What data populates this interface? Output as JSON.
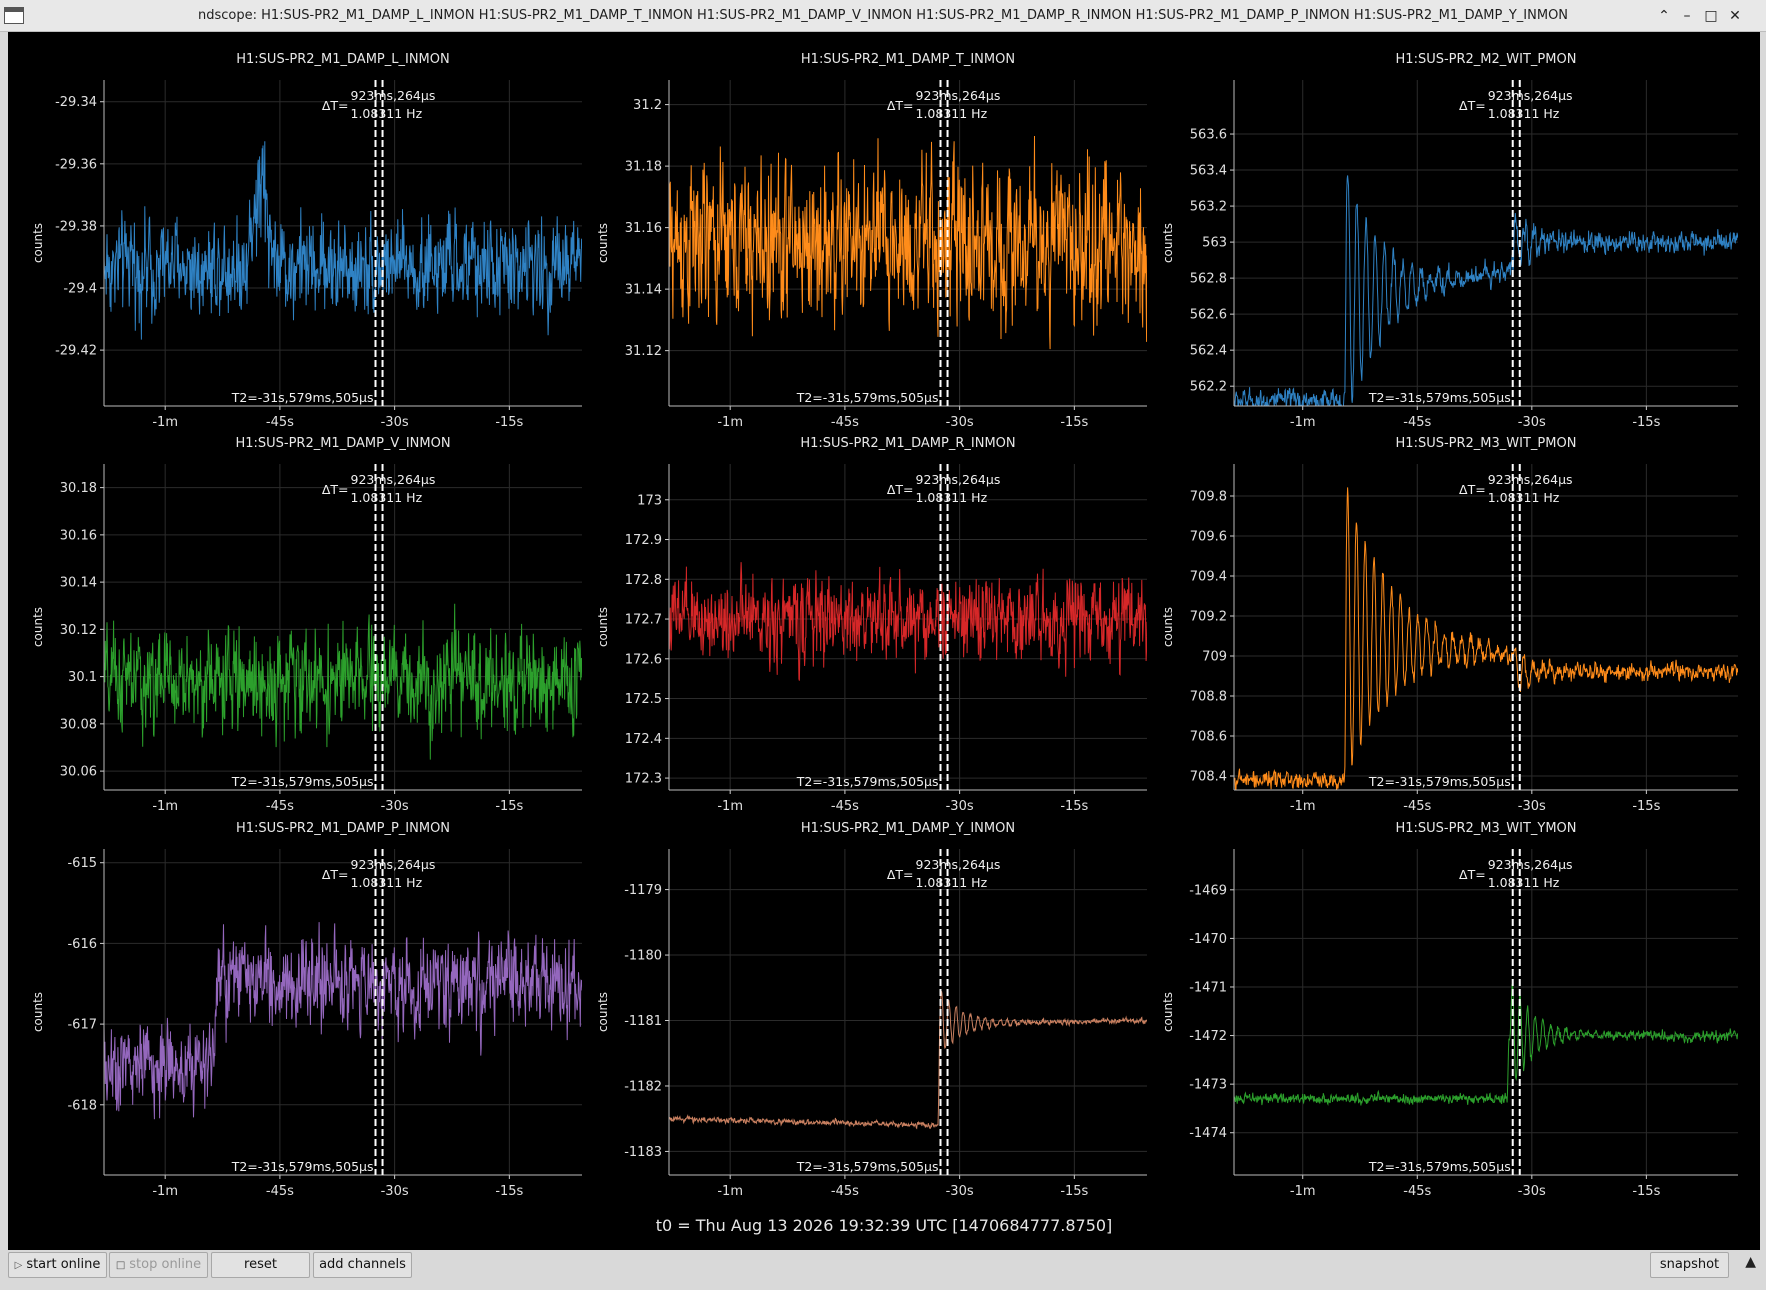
{
  "window": {
    "title": "ndscope: H1:SUS-PR2_M1_DAMP_L_INMON H1:SUS-PR2_M1_DAMP_T_INMON H1:SUS-PR2_M1_DAMP_V_INMON H1:SUS-PR2_M1_DAMP_R_INMON H1:SUS-PR2_M1_DAMP_P_INMON H1:SUS-PR2_M1_DAMP_Y_INMON",
    "controls": {
      "minimize": "⌃",
      "shade": "–",
      "maximize": "□",
      "close": "✕"
    }
  },
  "cursor": {
    "delta_label": "ΔT=",
    "delta_time": "923ms,264μs",
    "delta_freq": "1.08311 Hz",
    "t2_label": "T2=-31s,579ms,505μs",
    "t1_seconds": -32.5,
    "t2_seconds": -31.58
  },
  "t0_label": "t0 = Thu Aug 13 2026 19:32:39 UTC [1470684777.8750]",
  "buttons": {
    "start_online": "start online",
    "stop_online": "stop online",
    "reset": "reset",
    "add_channels": "add channels",
    "snapshot": "snapshot"
  },
  "chart_data": [
    {
      "type": "line",
      "title": "H1:SUS-PR2_M1_DAMP_L_INMON",
      "ylabel": "counts",
      "color": "#2f82c4",
      "xlim": [
        -68,
        -5.5
      ],
      "ylim": [
        -29.438,
        -29.333
      ],
      "xticks": [
        -60,
        -45,
        -30,
        -15
      ],
      "xtick_labels": [
        "-1m",
        "-45s",
        "-30s",
        "-15s"
      ],
      "yticks": [
        -29.34,
        -29.36,
        -29.38,
        -29.4,
        -29.42
      ],
      "yticks_labels": [
        "-29.34",
        "-29.36",
        "-29.38",
        "-29.4",
        "-29.42"
      ],
      "grid": true,
      "series": [
        {
          "shape": [
            [
              -68,
              -29.393
            ],
            [
              -5.5,
              -29.393
            ]
          ],
          "noise": 0.009,
          "spikes": [
            [
              -47.5,
              0.035
            ]
          ]
        }
      ]
    },
    {
      "type": "line",
      "title": "H1:SUS-PR2_M1_DAMP_T_INMON",
      "ylabel": "counts",
      "color": "#ff8c1a",
      "xlim": [
        -68,
        -5.5
      ],
      "ylim": [
        31.102,
        31.208
      ],
      "xticks": [
        -60,
        -45,
        -30,
        -15
      ],
      "xtick_labels": [
        "-1m",
        "-45s",
        "-30s",
        "-15s"
      ],
      "yticks": [
        31.2,
        31.18,
        31.16,
        31.14,
        31.12
      ],
      "yticks_labels": [
        "31.2",
        "31.18",
        "31.16",
        "31.14",
        "31.12"
      ],
      "grid": true,
      "series": [
        {
          "shape": [
            [
              -68,
              31.155
            ],
            [
              -5.5,
              31.155
            ]
          ],
          "noise": 0.015
        }
      ]
    },
    {
      "type": "line",
      "title": "H1:SUS-PR2_M2_WIT_PMON",
      "ylabel": "counts",
      "color": "#2f82c4",
      "xlim": [
        -69,
        -3
      ],
      "ylim": [
        562.09,
        563.9
      ],
      "xticks": [
        -60,
        -45,
        -30,
        -15
      ],
      "xtick_labels": [
        "-1m",
        "-45s",
        "-30s",
        "-15s"
      ],
      "yticks": [
        563.6,
        563.4,
        563.2,
        563,
        562.8,
        562.6,
        562.4,
        562.2
      ],
      "yticks_labels": [
        "563.6",
        "563.4",
        "563.2",
        "563",
        "562.8",
        "562.6",
        "562.4",
        "562.2"
      ],
      "grid": true,
      "series": [
        {
          "shape": [
            [
              -69,
              562.12
            ],
            [
              -54.5,
              562.12
            ],
            [
              -54.3,
              562.7
            ],
            [
              -32.5,
              562.85
            ],
            [
              -32.3,
              563
            ],
            [
              -3,
              563
            ]
          ],
          "noise": 0.035,
          "ringing": [
            [
              -54.4,
              0.75,
              4.5,
              1.2
            ],
            [
              -32.4,
              0.15,
              3,
              1.2
            ]
          ]
        }
      ]
    },
    {
      "type": "line",
      "title": "H1:SUS-PR2_M1_DAMP_V_INMON",
      "ylabel": "counts",
      "color": "#2ca02c",
      "xlim": [
        -68,
        -5.5
      ],
      "ylim": [
        30.052,
        30.19
      ],
      "xticks": [
        -60,
        -45,
        -30,
        -15
      ],
      "xtick_labels": [
        "-1m",
        "-45s",
        "-30s",
        "-15s"
      ],
      "yticks": [
        30.18,
        30.16,
        30.14,
        30.12,
        30.1,
        30.08,
        30.06
      ],
      "yticks_labels": [
        "30.18",
        "30.16",
        "30.14",
        "30.12",
        "30.1",
        "30.08",
        "30.06"
      ],
      "grid": true,
      "series": [
        {
          "shape": [
            [
              -68,
              30.098
            ],
            [
              -5.5,
              30.098
            ]
          ],
          "noise": 0.012
        }
      ]
    },
    {
      "type": "line",
      "title": "H1:SUS-PR2_M1_DAMP_R_INMON",
      "ylabel": "counts",
      "color": "#d62728",
      "xlim": [
        -68,
        -5.5
      ],
      "ylim": [
        172.27,
        173.09
      ],
      "xticks": [
        -60,
        -45,
        -30,
        -15
      ],
      "xtick_labels": [
        "-1m",
        "-45s",
        "-30s",
        "-15s"
      ],
      "yticks": [
        173,
        172.9,
        172.8,
        172.7,
        172.6,
        172.5,
        172.4,
        172.3
      ],
      "yticks_labels": [
        "173",
        "172.9",
        "172.8",
        "172.7",
        "172.6",
        "172.5",
        "172.4",
        "172.3"
      ],
      "grid": true,
      "series": [
        {
          "shape": [
            [
              -68,
              172.7
            ],
            [
              -5.5,
              172.7
            ]
          ],
          "noise": 0.06
        }
      ]
    },
    {
      "type": "line",
      "title": "H1:SUS-PR2_M3_WIT_PMON",
      "ylabel": "counts",
      "color": "#ff8c1a",
      "xlim": [
        -69,
        -3
      ],
      "ylim": [
        708.33,
        709.96
      ],
      "xticks": [
        -60,
        -45,
        -30,
        -15
      ],
      "xtick_labels": [
        "-1m",
        "-45s",
        "-30s",
        "-15s"
      ],
      "yticks": [
        709.8,
        709.6,
        709.4,
        709.2,
        709,
        708.8,
        708.6,
        708.4
      ],
      "yticks_labels": [
        "709.8",
        "709.6",
        "709.4",
        "709.2",
        "709",
        "708.8",
        "708.6",
        "708.4"
      ],
      "grid": true,
      "series": [
        {
          "shape": [
            [
              -69,
              708.38
            ],
            [
              -54.5,
              708.38
            ],
            [
              -54.3,
              709.1
            ],
            [
              -32.5,
              709.0
            ],
            [
              -32.3,
              708.92
            ],
            [
              -3,
              708.92
            ]
          ],
          "noise": 0.025,
          "ringing": [
            [
              -54.4,
              0.75,
              6,
              1.15
            ],
            [
              -32.4,
              0.12,
              2.5,
              1.15
            ]
          ]
        }
      ]
    },
    {
      "type": "line",
      "title": "H1:SUS-PR2_M1_DAMP_P_INMON",
      "ylabel": "counts",
      "color": "#9467bd",
      "xlim": [
        -68,
        -5.5
      ],
      "ylim": [
        -618.87,
        -614.83
      ],
      "xticks": [
        -60,
        -45,
        -30,
        -15
      ],
      "xtick_labels": [
        "-1m",
        "-45s",
        "-30s",
        "-15s"
      ],
      "yticks": [
        -615,
        -616,
        -617,
        -618
      ],
      "yticks_labels": [
        "-615",
        "-616",
        "-617",
        "-618"
      ],
      "grid": true,
      "series": [
        {
          "shape": [
            [
              -68,
              -617.5
            ],
            [
              -53.5,
              -617.5
            ],
            [
              -53.3,
              -616.5
            ],
            [
              -5.5,
              -616.5
            ]
          ],
          "noise": 0.32
        }
      ]
    },
    {
      "type": "line",
      "title": "H1:SUS-PR2_M1_DAMP_Y_INMON",
      "ylabel": "counts",
      "color": "#c98060",
      "xlim": [
        -68,
        -5.5
      ],
      "ylim": [
        -1183.36,
        -1178.38
      ],
      "xticks": [
        -60,
        -45,
        -30,
        -15
      ],
      "xtick_labels": [
        "-1m",
        "-45s",
        "-30s",
        "-15s"
      ],
      "yticks": [
        -1179,
        -1180,
        -1181,
        -1182,
        -1183
      ],
      "yticks_labels": [
        "-1179",
        "-1180",
        "-1181",
        "-1182",
        "-1183"
      ],
      "grid": true,
      "series": [
        {
          "shape": [
            [
              -68,
              -1182.5
            ],
            [
              -32.8,
              -1182.6
            ],
            [
              -32.6,
              -1181.05
            ],
            [
              -5.5,
              -1181.0
            ]
          ],
          "noise": 0.025,
          "ringing": [
            [
              -32.6,
              0.5,
              3,
              0.95
            ]
          ]
        }
      ]
    },
    {
      "type": "line",
      "title": "H1:SUS-PR2_M3_WIT_YMON",
      "ylabel": "counts",
      "color": "#2ca02c",
      "xlim": [
        -69,
        -3
      ],
      "ylim": [
        -1474.87,
        -1468.16
      ],
      "xticks": [
        -60,
        -45,
        -30,
        -15
      ],
      "xtick_labels": [
        "-1m",
        "-45s",
        "-30s",
        "-15s"
      ],
      "yticks": [
        -1469,
        -1470,
        -1471,
        -1472,
        -1473,
        -1474
      ],
      "yticks_labels": [
        "-1469",
        "-1470",
        "-1471",
        "-1472",
        "-1473",
        "-1474"
      ],
      "grid": true,
      "series": [
        {
          "shape": [
            [
              -69,
              -1473.3
            ],
            [
              -33.2,
              -1473.3
            ],
            [
              -33,
              -1472.0
            ],
            [
              -3,
              -1472.0
            ]
          ],
          "noise": 0.06,
          "ringing": [
            [
              -32.8,
              1.2,
              3,
              1.0
            ]
          ]
        }
      ]
    }
  ]
}
